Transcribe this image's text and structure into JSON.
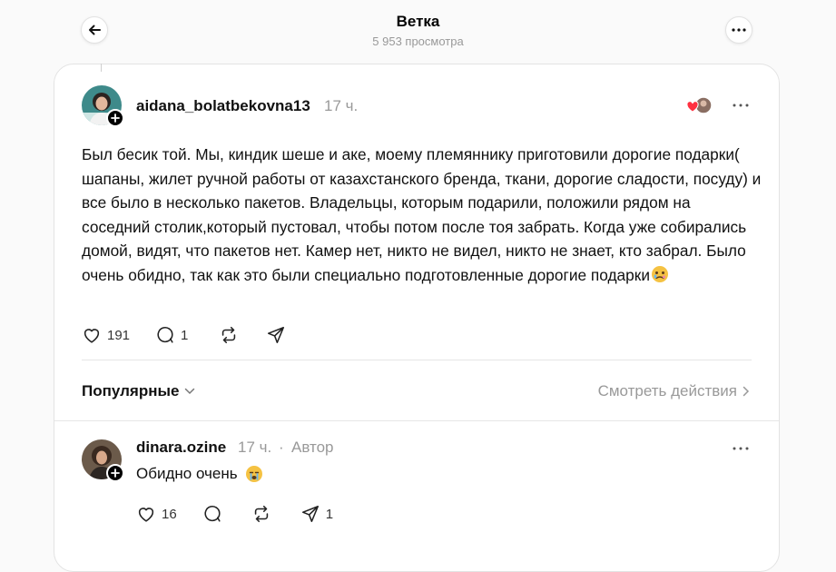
{
  "header": {
    "title": "Ветка",
    "views": "5 953 просмотра"
  },
  "post": {
    "username": "aidana_bolatbekovna13",
    "time": "17 ч.",
    "text": "Был бесик той. Мы, киндик шеше и аке, моему племяннику приготовили дорогие подарки( шапаны, жилет ручной работы от казахстанского бренда, ткани, дорогие сладости, посуду) и все было в несколько пакетов. Владельцы, которым подарили, положили рядом на соседний столик,который пустовал, чтобы потом после тоя забрать. Когда уже собирались домой, видят, что пакетов нет. Камер нет, никто не видел, никто не знает, кто забрал. Было очень обидно, так как это были специально подготовленные дорогие подарки",
    "emoji": "face-with-tear-emoji",
    "likes": "191",
    "comments": "1"
  },
  "sort": {
    "label": "Популярные",
    "view_activity": "Смотреть действия"
  },
  "reply": {
    "username": "dinara.ozine",
    "time": "17 ч.",
    "separator": "·",
    "author_label": "Автор",
    "text": "Обидно очень",
    "emoji": "crying-emoji",
    "likes": "16",
    "shares": "1"
  },
  "colors": {
    "accent_heart": "#ff3040",
    "muted": "#999999",
    "border": "#e3e3e3"
  }
}
